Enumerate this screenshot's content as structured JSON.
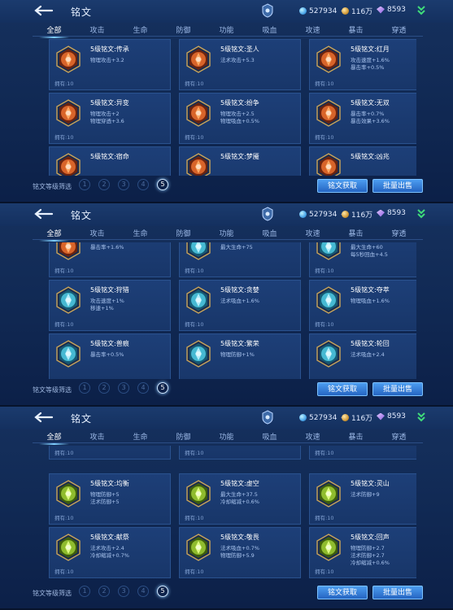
{
  "panels": [
    {
      "title": "铭文",
      "resources": {
        "diamonds": "527934",
        "coins": "116万",
        "crystals": "8593"
      },
      "tabs": [
        "全部",
        "攻击",
        "生命",
        "防御",
        "功能",
        "吸血",
        "攻速",
        "暴击",
        "穿透"
      ],
      "active_tab": 0,
      "cards": [
        {
          "name": "5级铭文:传承",
          "stats": [
            "物理攻击+3.2"
          ],
          "owned": "拥有:10",
          "color": "orange",
          "partial": ""
        },
        {
          "name": "5级铭文:圣人",
          "stats": [
            "法术攻击+5.3"
          ],
          "owned": "拥有:10",
          "color": "orange",
          "partial": ""
        },
        {
          "name": "5级铭文:红月",
          "stats": [
            "攻击速度+1.6%",
            "暴击率+0.5%"
          ],
          "owned": "拥有:10",
          "color": "orange",
          "partial": ""
        },
        {
          "name": "5级铭文:异变",
          "stats": [
            "物理攻击+2",
            "物理穿透+3.6"
          ],
          "owned": "拥有:10",
          "color": "orange",
          "partial": ""
        },
        {
          "name": "5级铭文:纷争",
          "stats": [
            "物理攻击+2.5",
            "物理吸血+0.5%"
          ],
          "owned": "拥有:10",
          "color": "orange",
          "partial": ""
        },
        {
          "name": "5级铭文:无双",
          "stats": [
            "暴击率+0.7%",
            "暴击效果+3.6%"
          ],
          "owned": "拥有:10",
          "color": "orange",
          "partial": ""
        },
        {
          "name": "5级铭文:宿命",
          "stats": [],
          "owned": "",
          "color": "orange",
          "partial": "bottom"
        },
        {
          "name": "5级铭文:梦魇",
          "stats": [],
          "owned": "",
          "color": "orange",
          "partial": "bottom"
        },
        {
          "name": "5级铭文:凶兆",
          "stats": [],
          "owned": "",
          "color": "orange",
          "partial": "bottom"
        }
      ],
      "filter_label": "铭文等级筛选",
      "levels": [
        "1",
        "2",
        "3",
        "4",
        "5"
      ],
      "active_level": 4,
      "buttons": {
        "get": "铭文获取",
        "sell": "批量出售"
      }
    },
    {
      "title": "铭文",
      "resources": {
        "diamonds": "527934",
        "coins": "116万",
        "crystals": "8593"
      },
      "tabs": [
        "全部",
        "攻击",
        "生命",
        "防御",
        "功能",
        "吸血",
        "攻速",
        "暴击",
        "穿透"
      ],
      "active_tab": 0,
      "cards": [
        {
          "name": "5级铭文:祸源",
          "stats": [
            "暴击率+1.6%"
          ],
          "owned": "拥有:10",
          "color": "orange",
          "partial": "top"
        },
        {
          "name": "5级铭文:长生",
          "stats": [
            "最大生命+75"
          ],
          "owned": "拥有:10",
          "color": "cyan",
          "partial": "top"
        },
        {
          "name": "5级铭文:冥想",
          "stats": [
            "最大生命+60",
            "每5秒回血+4.5"
          ],
          "owned": "拥有:10",
          "color": "cyan",
          "partial": "top"
        },
        {
          "name": "5级铭文:狩猎",
          "stats": [
            "攻击速度+1%",
            "移速+1%"
          ],
          "owned": "拥有:10",
          "color": "cyan",
          "partial": ""
        },
        {
          "name": "5级铭文:贪婪",
          "stats": [
            "法术吸血+1.6%"
          ],
          "owned": "拥有:10",
          "color": "cyan",
          "partial": ""
        },
        {
          "name": "5级铭文:夺萃",
          "stats": [
            "物理吸血+1.6%"
          ],
          "owned": "拥有:10",
          "color": "cyan",
          "partial": ""
        },
        {
          "name": "5级铭文:兽痕",
          "stats": [
            "暴击率+0.5%"
          ],
          "owned": "",
          "color": "cyan",
          "partial": "bottom"
        },
        {
          "name": "5级铭文:繁荣",
          "stats": [
            "物理防御+1%"
          ],
          "owned": "",
          "color": "cyan",
          "partial": "bottom"
        },
        {
          "name": "5级铭文:轮回",
          "stats": [
            "法术吸血+2.4"
          ],
          "owned": "",
          "color": "cyan",
          "partial": "bottom"
        }
      ],
      "filter_label": "铭文等级筛选",
      "levels": [
        "1",
        "2",
        "3",
        "4",
        "5"
      ],
      "active_level": 4,
      "buttons": {
        "get": "铭文获取",
        "sell": "批量出售"
      }
    },
    {
      "title": "铭文",
      "resources": {
        "diamonds": "527934",
        "coins": "116万",
        "crystals": "8593"
      },
      "tabs": [
        "全部",
        "攻击",
        "生命",
        "防御",
        "功能",
        "吸血",
        "攻速",
        "暴击",
        "穿透"
      ],
      "active_tab": 0,
      "cards": [
        {
          "name": "",
          "stats": [],
          "owned": "拥有:10",
          "color": "green",
          "partial": "top-own"
        },
        {
          "name": "",
          "stats": [],
          "owned": "拥有:10",
          "color": "green",
          "partial": "top-own"
        },
        {
          "name": "",
          "stats": [],
          "owned": "拥有:10",
          "color": "green",
          "partial": "top-own"
        },
        {
          "name": "5级铭文:均衡",
          "stats": [
            "物理防御+5",
            "法术防御+5"
          ],
          "owned": "拥有:10",
          "color": "green",
          "partial": ""
        },
        {
          "name": "5级铭文:虚空",
          "stats": [
            "最大生命+37.5",
            "冷却缩减+0.6%"
          ],
          "owned": "拥有:10",
          "color": "green",
          "partial": ""
        },
        {
          "name": "5级铭文:灵山",
          "stats": [
            "法术防御+9"
          ],
          "owned": "拥有:10",
          "color": "green",
          "partial": ""
        },
        {
          "name": "5级铭文:献祭",
          "stats": [
            "法术攻击+2.4",
            "冷却缩减+0.7%"
          ],
          "owned": "拥有:10",
          "color": "green",
          "partial": ""
        },
        {
          "name": "5级铭文:敬畏",
          "stats": [
            "法术吸血+0.7%",
            "物理防御+5.9"
          ],
          "owned": "拥有:10",
          "color": "green",
          "partial": ""
        },
        {
          "name": "5级铭文:回声",
          "stats": [
            "物理防御+2.7",
            "法术防御+2.7",
            "冷却缩减+0.6%"
          ],
          "owned": "拥有:10",
          "color": "green",
          "partial": ""
        }
      ],
      "filter_label": "铭文等级筛选",
      "levels": [
        "1",
        "2",
        "3",
        "4",
        "5"
      ],
      "active_level": 4,
      "buttons": {
        "get": "铭文获取",
        "sell": "批量出售"
      }
    }
  ],
  "icon_names": {
    "back": "back-arrow-icon",
    "badge": "shield-badge-icon",
    "diamond": "diamond-icon",
    "coin": "gold-coin-icon",
    "crystal": "crystal-icon",
    "arrow": "green-arrow-icon",
    "plus": "plus-icon"
  },
  "colors": {
    "orange": "#d8642a",
    "cyan": "#46b9d2",
    "green": "#8fbc2e",
    "button": "#2f7fe0",
    "background": "#112a55"
  }
}
